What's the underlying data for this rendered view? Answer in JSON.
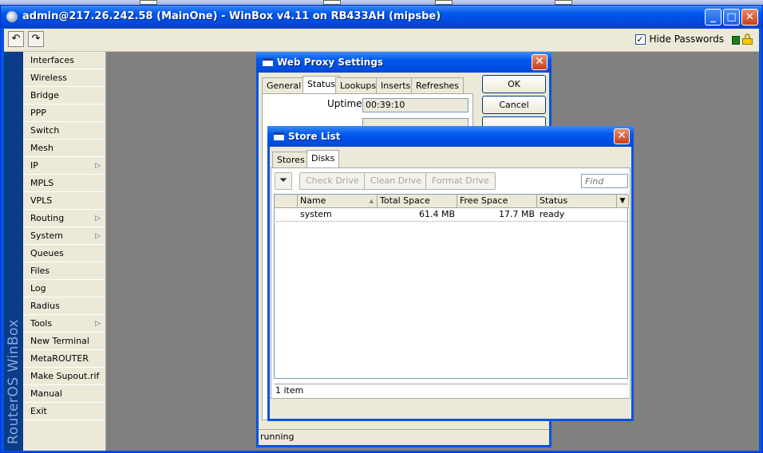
{
  "main_window": {
    "title": "admin@217.26.242.58 (MainOne) - WinBox v4.11 on RB433AH (mipsbe)",
    "minimize": "_",
    "maximize": "□",
    "close": "✕"
  },
  "toolbar": {
    "undo_icon": "↶",
    "redo_icon": "↷",
    "hide_passwords_label": "Hide Passwords",
    "hide_passwords_checked": "✓"
  },
  "brand": {
    "vertical_text": "RouterOS WinBox"
  },
  "sidebar": {
    "items": [
      {
        "label": "Interfaces",
        "submenu": ""
      },
      {
        "label": "Wireless",
        "submenu": ""
      },
      {
        "label": "Bridge",
        "submenu": ""
      },
      {
        "label": "PPP",
        "submenu": ""
      },
      {
        "label": "Switch",
        "submenu": ""
      },
      {
        "label": "Mesh",
        "submenu": ""
      },
      {
        "label": "IP",
        "submenu": "▷"
      },
      {
        "label": "MPLS",
        "submenu": ""
      },
      {
        "label": "VPLS",
        "submenu": ""
      },
      {
        "label": "Routing",
        "submenu": "▷"
      },
      {
        "label": "System",
        "submenu": "▷"
      },
      {
        "label": "Queues",
        "submenu": ""
      },
      {
        "label": "Files",
        "submenu": ""
      },
      {
        "label": "Log",
        "submenu": ""
      },
      {
        "label": "Radius",
        "submenu": ""
      },
      {
        "label": "Tools",
        "submenu": "▷"
      },
      {
        "label": "New Terminal",
        "submenu": ""
      },
      {
        "label": "MetaROUTER",
        "submenu": ""
      },
      {
        "label": "Make Supout.rif",
        "submenu": ""
      },
      {
        "label": "Manual",
        "submenu": ""
      },
      {
        "label": "Exit",
        "submenu": ""
      }
    ]
  },
  "web_proxy": {
    "title": "Web Proxy Settings",
    "close": "✕",
    "tabs": [
      "General",
      "Status",
      "Lookups",
      "Inserts",
      "Refreshes"
    ],
    "active_tab": "Status",
    "uptime_label": "Uptime:",
    "uptime_value": "00:39:10",
    "ok_label": "OK",
    "cancel_label": "Cancel",
    "status_text": "running"
  },
  "store_list": {
    "title": "Store List",
    "close": "✕",
    "tabs": [
      "Stores",
      "Disks"
    ],
    "active_tab": "Disks",
    "filter_icon": "⏷",
    "buttons": [
      "Check Drive",
      "Clean Drive",
      "Format Drive"
    ],
    "find_placeholder": "Find",
    "columns": [
      "Name",
      "Total Space",
      "Free Space",
      "Status"
    ],
    "sort_indicator": "▲",
    "dropdown_icon": "▼",
    "rows": [
      {
        "name": "system",
        "total": "61.4 MB",
        "free": "17.7 MB",
        "status": "ready"
      }
    ],
    "footer": "1 item"
  }
}
